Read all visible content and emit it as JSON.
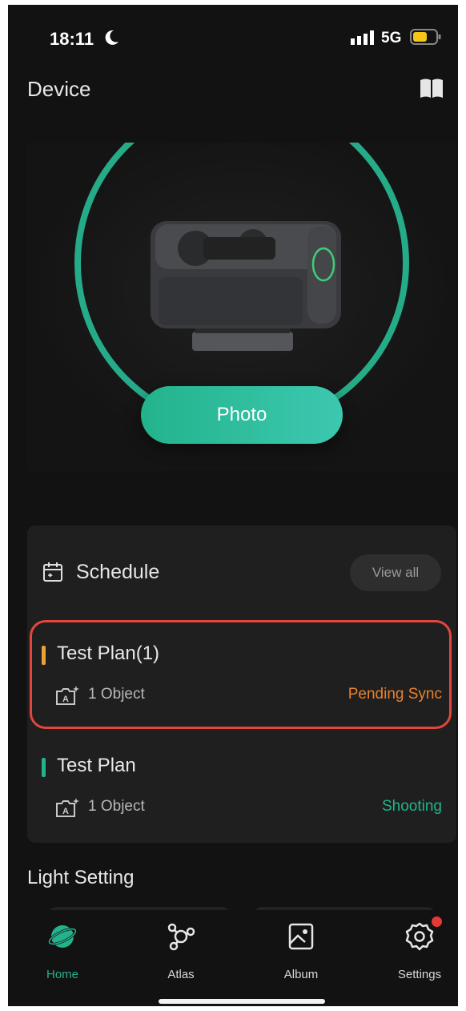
{
  "status_bar": {
    "time": "18:11",
    "network": "5G"
  },
  "header": {
    "title": "Device"
  },
  "hero": {
    "photo_button_label": "Photo"
  },
  "schedule": {
    "title": "Schedule",
    "view_all_label": "View all",
    "plans": [
      {
        "name": "Test Plan(1)",
        "object_count": "1 Object",
        "status": "Pending Sync",
        "status_color": "#e8822a",
        "accent_color": "#e8a23a"
      },
      {
        "name": "Test Plan",
        "object_count": "1 Object",
        "status": "Shooting",
        "status_color": "#23b38c",
        "accent_color": "#23b38c"
      }
    ]
  },
  "light_setting": {
    "title": "Light Setting"
  },
  "tab_bar": {
    "items": [
      {
        "label": "Home",
        "icon": "planet-icon",
        "active": true
      },
      {
        "label": "Atlas",
        "icon": "network-icon"
      },
      {
        "label": "Album",
        "icon": "image-icon"
      },
      {
        "label": "Settings",
        "icon": "gear-icon",
        "badge": true
      }
    ]
  },
  "colors": {
    "accent": "#23b38c",
    "background": "#121212",
    "card": "#1f1f1f",
    "highlight_border": "#e2463c"
  }
}
